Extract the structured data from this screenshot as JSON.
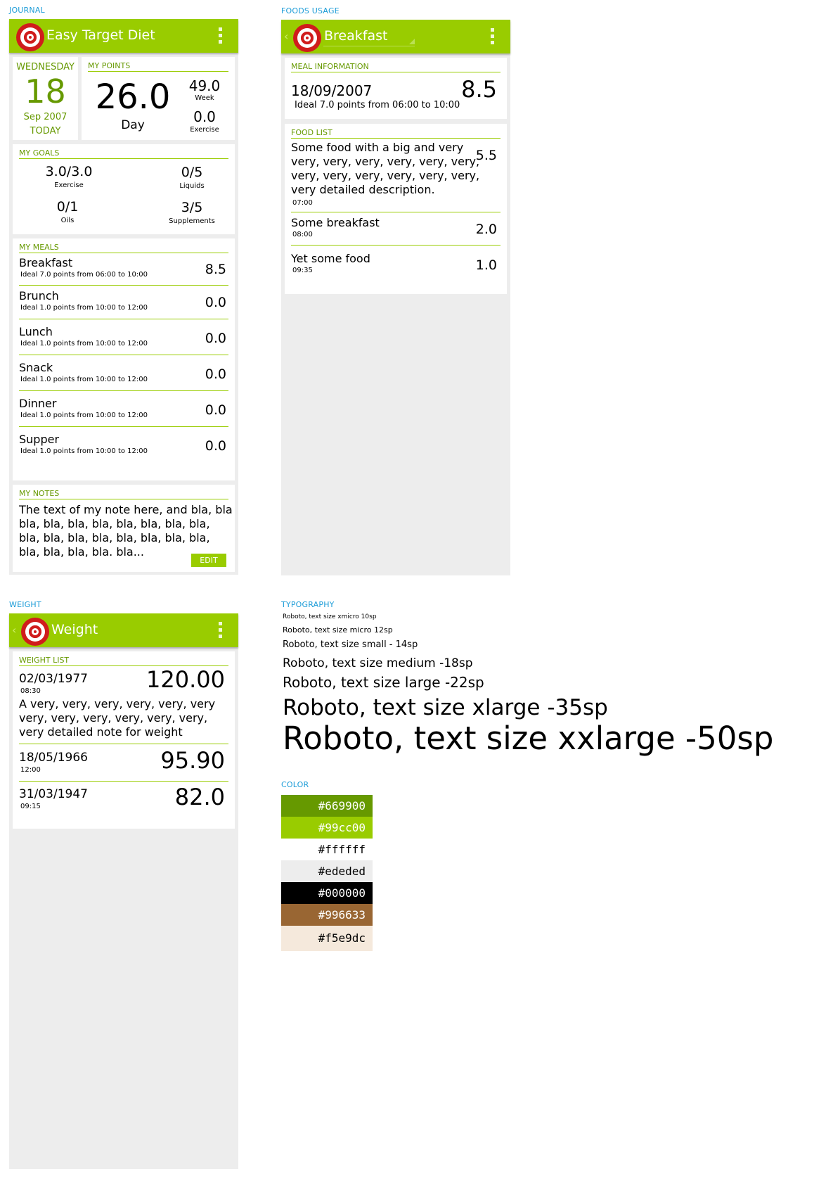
{
  "labels": {
    "journal": "JOURNAL",
    "foods_usage": "FOODS USAGE",
    "weight": "WEIGHT",
    "typography": "TYPOGRAPHY",
    "color": "COLOR"
  },
  "journal": {
    "title": "Easy Target Diet",
    "date": {
      "weekday": "WEDNESDAY",
      "day": "18",
      "month_year": "Sep 2007",
      "relative": "TODAY"
    },
    "points": {
      "header": "MY POINTS",
      "day_value": "26.0",
      "day_label": "Day",
      "week_value": "49.0",
      "week_label": "Week",
      "exercise_value": "0.0",
      "exercise_label": "Exercise"
    },
    "goals": {
      "header": "MY GOALS",
      "items": [
        {
          "value": "3.0/3.0",
          "label": "Exercise"
        },
        {
          "value": "0/5",
          "label": "Liquids"
        },
        {
          "value": "0/1",
          "label": "Oils"
        },
        {
          "value": "3/5",
          "label": "Supplements"
        }
      ]
    },
    "meals": {
      "header": "MY MEALS",
      "items": [
        {
          "name": "Breakfast",
          "ideal": "Ideal 7.0 points from 06:00 to 10:00",
          "points": "8.5"
        },
        {
          "name": "Brunch",
          "ideal": "Ideal 1.0 points from 10:00 to 12:00",
          "points": "0.0"
        },
        {
          "name": "Lunch",
          "ideal": "Ideal 1.0 points from 10:00 to 12:00",
          "points": "0.0"
        },
        {
          "name": "Snack",
          "ideal": "Ideal 1.0 points from 10:00 to 12:00",
          "points": "0.0"
        },
        {
          "name": "Dinner",
          "ideal": "Ideal 1.0 points from 10:00 to 12:00",
          "points": "0.0"
        },
        {
          "name": "Supper",
          "ideal": "Ideal 1.0 points from 10:00 to 12:00",
          "points": "0.0"
        }
      ]
    },
    "notes": {
      "header": "MY NOTES",
      "lines": [
        "The text of my note here, and bla, bla",
        "bla, bla, bla, bla, bla, bla, bla, bla,",
        "bla, bla, bla, bla, bla, bla, bla, bla,",
        "bla, bla, bla, bla. bla..."
      ],
      "edit_label": "EDIT"
    }
  },
  "foods": {
    "title": "Breakfast",
    "meal_info": {
      "header": "MEAL INFORMATION",
      "date": "18/09/2007",
      "points": "8.5",
      "ideal": "Ideal 7.0 points from 06:00 to 10:00"
    },
    "food_list": {
      "header": "FOOD LIST",
      "items": [
        {
          "lines": [
            "Some food with a big and very",
            "very, very, very, very, very, very,",
            "very, very, very, very, very, very,",
            "very detailed description."
          ],
          "time": "07:00",
          "points": "5.5"
        },
        {
          "lines": [
            "Some breakfast"
          ],
          "time": "08:00",
          "points": "2.0"
        },
        {
          "lines": [
            "Yet some food"
          ],
          "time": "09:35",
          "points": "1.0"
        }
      ]
    }
  },
  "weight": {
    "title": "Weight",
    "header": "WEIGHT LIST",
    "items": [
      {
        "date": "02/03/1977",
        "time": "08:30",
        "value": "120.00",
        "note": [
          "A very, very, very, very, very, very",
          "very, very, very, very, very, very,",
          "very detailed note for weight"
        ]
      },
      {
        "date": "18/05/1966",
        "time": "12:00",
        "value": "95.90",
        "note": []
      },
      {
        "date": "31/03/1947",
        "time": "09:15",
        "value": "82.0",
        "note": []
      }
    ]
  },
  "typography": [
    "Roboto, text size xmicro 10sp",
    "Roboto, text size micro 12sp",
    "Roboto, text size small - 14sp",
    "Roboto, text size medium -18sp",
    "Roboto, text size large -22sp",
    "Roboto, text size xlarge -35sp",
    "Roboto, text size xxlarge -50sp"
  ],
  "colors": [
    {
      "hex": "#669900",
      "bg": "#669900",
      "fg": "#ffffff"
    },
    {
      "hex": "#99cc00",
      "bg": "#99cc00",
      "fg": "#ffffff"
    },
    {
      "hex": "#ffffff",
      "bg": "#ffffff",
      "fg": "#000000"
    },
    {
      "hex": "#ededed",
      "bg": "#ededed",
      "fg": "#000000"
    },
    {
      "hex": "#000000",
      "bg": "#000000",
      "fg": "#ffffff"
    },
    {
      "hex": "#996633",
      "bg": "#996633",
      "fg": "#ffffff"
    },
    {
      "hex": "#f5e9dc",
      "bg": "#f5e9dc",
      "fg": "#000000"
    }
  ]
}
